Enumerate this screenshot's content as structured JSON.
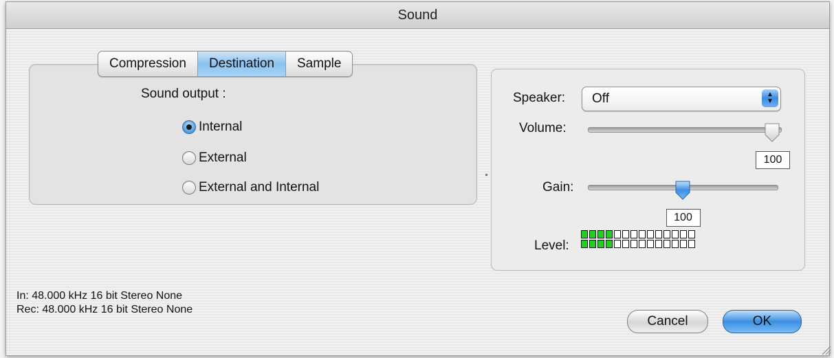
{
  "window": {
    "title": "Sound"
  },
  "tabs": [
    {
      "label": "Compression",
      "active": false
    },
    {
      "label": "Destination",
      "active": true
    },
    {
      "label": "Sample",
      "active": false
    }
  ],
  "sound_output": {
    "label": "Sound output :",
    "options": [
      {
        "label": "Internal",
        "checked": true
      },
      {
        "label": "External",
        "checked": false
      },
      {
        "label": "External and Internal",
        "checked": false
      }
    ]
  },
  "speaker": {
    "label": "Speaker:",
    "value": "Off"
  },
  "volume": {
    "label": "Volume:",
    "value": "100",
    "level": 1.0
  },
  "gain": {
    "label": "Gain:",
    "value": "100",
    "level": 0.5
  },
  "level_meter": {
    "label": "Level:",
    "cells_per_row": 14,
    "lit": [
      4,
      4
    ]
  },
  "info": {
    "in": "In: 48.000 kHz 16 bit Stereo None",
    "rec": "Rec: 48.000 kHz 16 bit Stereo None"
  },
  "buttons": {
    "cancel": "Cancel",
    "ok": "OK"
  },
  "colors": {
    "accent": "#3b8fe2",
    "meter_on": "#22d022"
  }
}
